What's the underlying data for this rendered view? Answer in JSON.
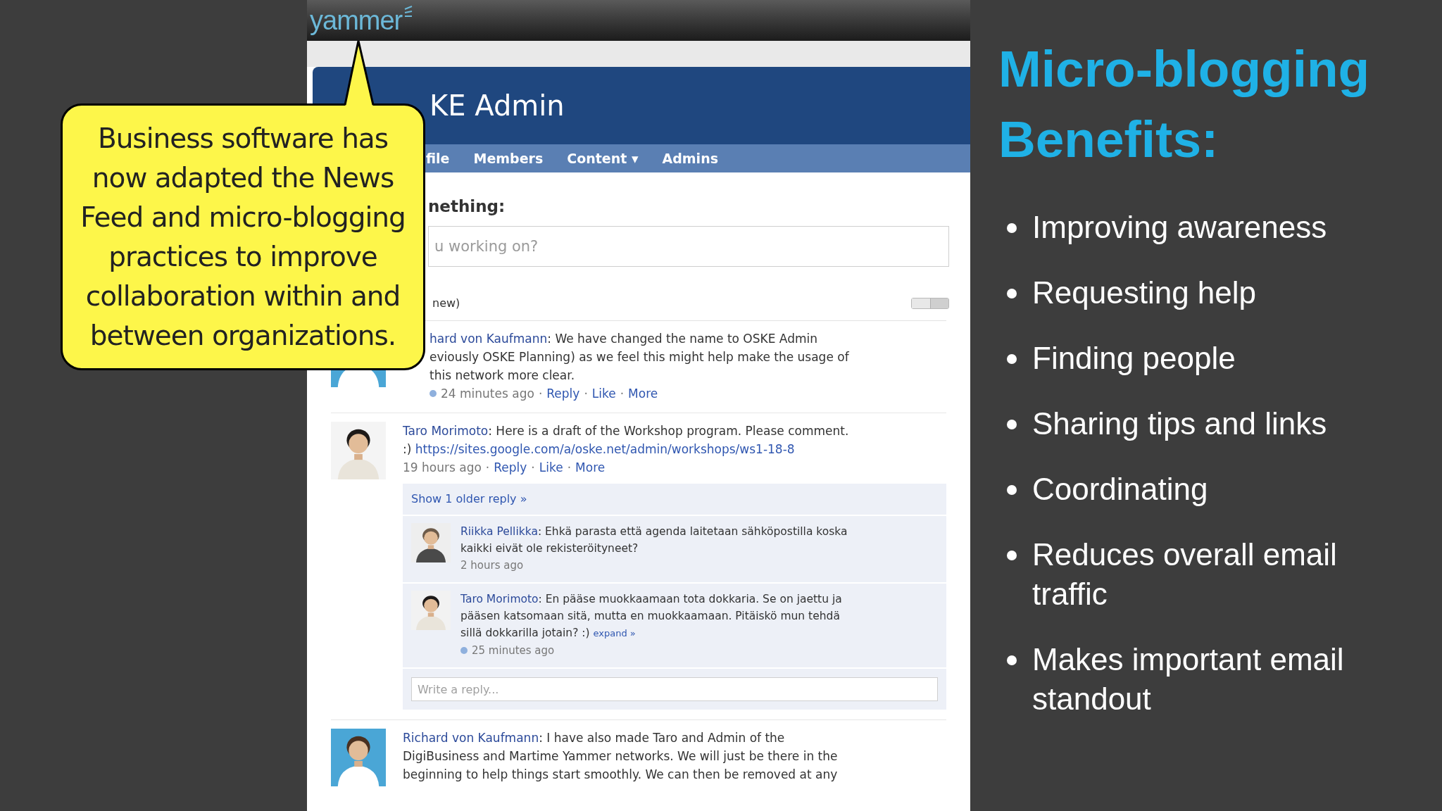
{
  "screenshot": {
    "logo": "yammer",
    "header_title": "KE Admin",
    "nav_tabs": [
      {
        "label": "file"
      },
      {
        "label": "Members"
      },
      {
        "label": "Content",
        "caret": "▾"
      },
      {
        "label": "Admins"
      }
    ],
    "composer": {
      "prompt": "nething:",
      "placeholder": "u working on?"
    },
    "feed_filter": "new)",
    "posts": [
      {
        "avatar": {
          "kind": "picture",
          "cropped": true
        },
        "body": [
          {
            "kind": "author",
            "text": "hard von Kaufmann"
          },
          {
            "kind": "text",
            "text": ": We have changed the name to OSKE Admin\neviously OSKE Planning) as we feel this might help make the usage of\nthis network more clear."
          }
        ],
        "meta": {
          "dot": true,
          "items": [
            {
              "kind": "time",
              "text": "24 minutes ago"
            },
            {
              "kind": "sep",
              "text": "·"
            },
            {
              "kind": "link",
              "text": "Reply"
            },
            {
              "kind": "sep",
              "text": "·"
            },
            {
              "kind": "link",
              "text": "Like"
            },
            {
              "kind": "sep",
              "text": "·"
            },
            {
              "kind": "link",
              "text": "More"
            }
          ]
        }
      },
      {
        "avatar": {
          "kind": "picture",
          "cropped": false
        },
        "body": [
          {
            "kind": "author",
            "text": "Taro Morimoto"
          },
          {
            "kind": "text",
            "text": ": Here is a draft of the Workshop program. Please comment.\n:) "
          },
          {
            "kind": "link",
            "text": "https://sites.google.com/a/oske.net/admin/workshops/ws1-18-8"
          }
        ],
        "meta": {
          "dot": false,
          "items": [
            {
              "kind": "time",
              "text": "19 hours ago"
            },
            {
              "kind": "sep",
              "text": "·"
            },
            {
              "kind": "link",
              "text": "Reply"
            },
            {
              "kind": "sep",
              "text": "·"
            },
            {
              "kind": "link",
              "text": "Like"
            },
            {
              "kind": "sep",
              "text": "·"
            },
            {
              "kind": "link",
              "text": "More"
            }
          ]
        },
        "thread": {
          "show_older": "Show 1 older reply »",
          "reply_placeholder": "Write a reply...",
          "replies": [
            {
              "avatar": {
                "kind": "picture",
                "cropped": false
              },
              "body": [
                {
                  "kind": "author",
                  "text": "Riikka Pellikka"
                },
                {
                  "kind": "text",
                  "text": ": Ehkä parasta että agenda laitetaan sähköpostilla koska\nkaikki eivät ole rekisteröityneet?"
                }
              ],
              "meta": {
                "dot": false,
                "items": [
                  {
                    "kind": "time",
                    "text": "2 hours ago"
                  }
                ]
              }
            },
            {
              "avatar": {
                "kind": "picture",
                "cropped": false
              },
              "body": [
                {
                  "kind": "author",
                  "text": "Taro Morimoto"
                },
                {
                  "kind": "text",
                  "text": ": En pääse muokkaamaan tota dokkaria. Se on jaettu ja\npääsen katsomaan sitä, mutta en muokkaamaan. Pitäiskö mun tehdä\nsillä dokkarilla jotain? :) "
                },
                {
                  "kind": "small_link",
                  "text": "expand »"
                }
              ],
              "meta": {
                "dot": true,
                "items": [
                  {
                    "kind": "time",
                    "text": "25 minutes ago"
                  }
                ]
              }
            }
          ]
        }
      },
      {
        "avatar": {
          "kind": "picture",
          "cropped": false
        },
        "body": [
          {
            "kind": "author",
            "text": "Richard von Kaufmann"
          },
          {
            "kind": "text",
            "text": ": I have also made Taro and Admin of the\nDigiBusiness and Martime Yammer networks. We will just be there in the\nbeginning to help things start smoothly. We can then be removed at any"
          }
        ]
      }
    ]
  },
  "callout": {
    "text": "Business software has\nnow adapted the News\nFeed and micro-blogging\npractices to improve\ncollaboration within and\nbetween organizations."
  },
  "slide": {
    "title": "Micro-blogging\nBenefits:",
    "bullets": [
      "Improving awareness",
      "Requesting help",
      "Finding people",
      "Sharing tips and links",
      "Coordinating",
      "Reduces overall email traffic",
      "Makes important email standout"
    ]
  }
}
